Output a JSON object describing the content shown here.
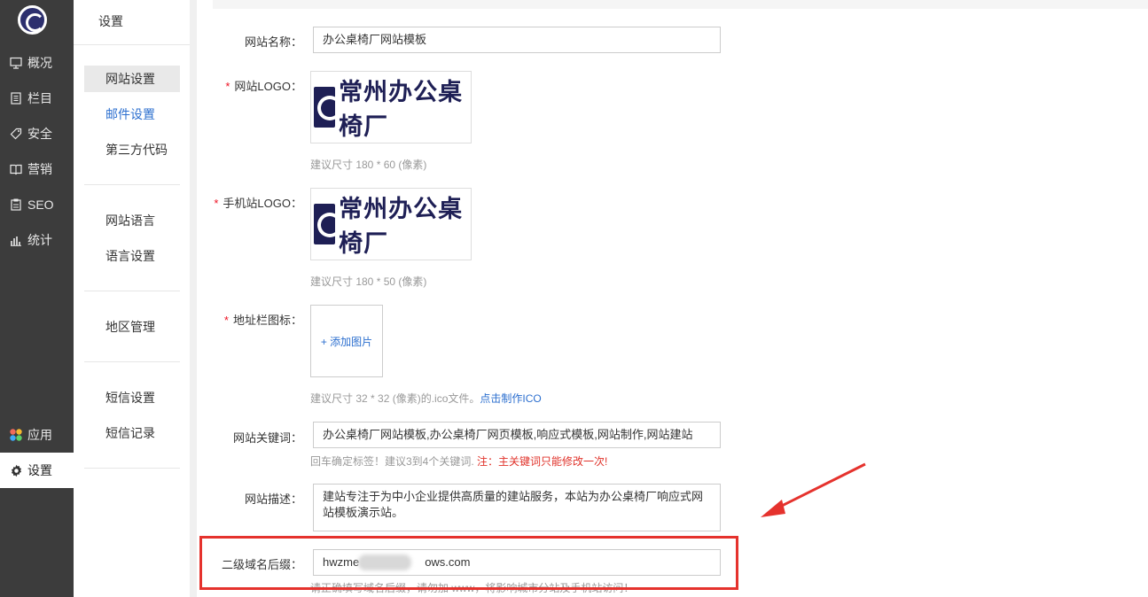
{
  "nav": {
    "items": [
      {
        "label": "概况",
        "icon": "monitor-icon"
      },
      {
        "label": "栏目",
        "icon": "list-icon"
      },
      {
        "label": "安全",
        "icon": "tag-icon"
      },
      {
        "label": "营销",
        "icon": "book-icon"
      },
      {
        "label": "SEO",
        "icon": "clipboard-icon"
      },
      {
        "label": "统计",
        "icon": "bar-chart-icon"
      },
      {
        "label": "应用",
        "icon": "apps-icon"
      },
      {
        "label": "设置",
        "icon": "gear-icon"
      }
    ]
  },
  "sub": {
    "title": "设置",
    "items": [
      "网站设置",
      "邮件设置",
      "第三方代码",
      "网站语言",
      "语言设置",
      "地区管理",
      "短信设置",
      "短信记录"
    ]
  },
  "form": {
    "site_name_label": "网站名称：",
    "site_name_value": "办公桌椅厂网站模板",
    "logo_label": "网站LOGO：",
    "logo_text": "常州办公桌椅厂",
    "logo_hint": "建议尺寸 180 * 60 (像素)",
    "mobile_logo_label": "手机站LOGO：",
    "mobile_logo_hint": "建议尺寸 180 * 50 (像素)",
    "favicon_label": "地址栏图标：",
    "favicon_upload": "+ 添加图片",
    "favicon_hint": "建议尺寸 32 * 32 (像素)的.ico文件。",
    "favicon_link": "点击制作ICO",
    "keywords_label": "网站关键词：",
    "keywords_value": "办公桌椅厂网站模板,办公桌椅厂网页模板,响应式模板,网站制作,网站建站",
    "keywords_hint": "回车确定标签！建议3到4个关键词.",
    "keywords_warn": "注：主关键词只能修改一次!",
    "desc_label": "网站描述：",
    "desc_value": "建站专注于为中小企业提供高质量的建站服务，本站为办公桌椅厂响应式网站模板演示站。",
    "domain_label": "二级域名后缀：",
    "domain_value_prefix": "hwzme",
    "domain_value_suffix": "ows.com",
    "domain_hint": "请正确填写域名后缀，请勿加 www，将影响城市分站及手机站访问！"
  },
  "colors": {
    "nav_bg": "#3c3c3c",
    "link_blue": "#2c6fcf",
    "warn_red": "#e0322a",
    "highlight_red": "#e5322d"
  }
}
